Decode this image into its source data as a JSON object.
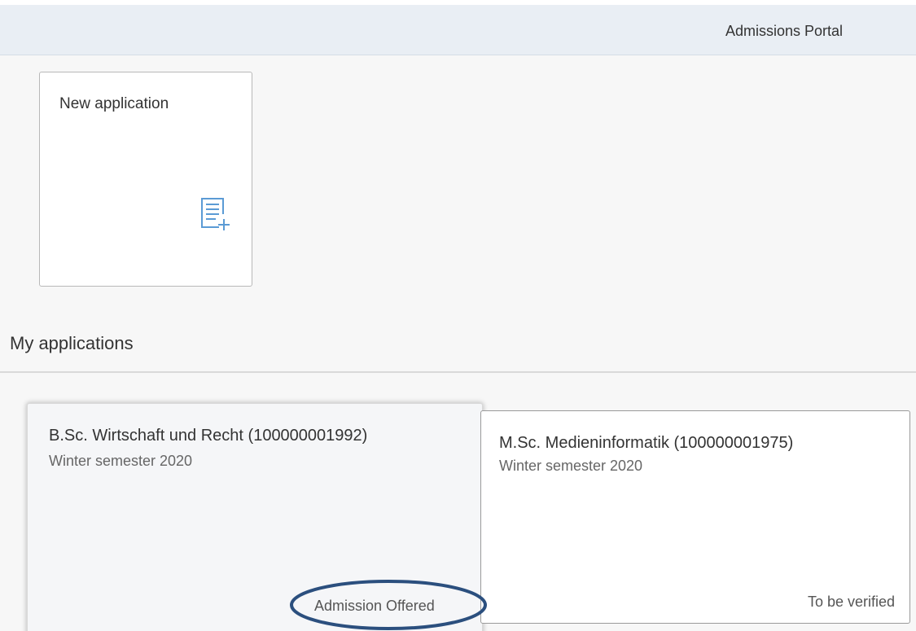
{
  "header": {
    "title": "Admissions Portal"
  },
  "new_tile": {
    "label": "New application",
    "icon": "document-add-icon",
    "icon_color": "#5b9bd5"
  },
  "section": {
    "title": "My applications"
  },
  "applications": [
    {
      "title": "B.Sc. Wirtschaft und Recht (100000001992)",
      "semester": "Winter semester 2020",
      "status": "Admission Offered"
    },
    {
      "title": "M.Sc. Medieninformatik (100000001975)",
      "semester": "Winter semester 2020",
      "status": "To be verified"
    }
  ],
  "colors": {
    "header_bg": "#e9eef4",
    "annotation": "#2b4f7e",
    "icon": "#5b9bd5"
  }
}
